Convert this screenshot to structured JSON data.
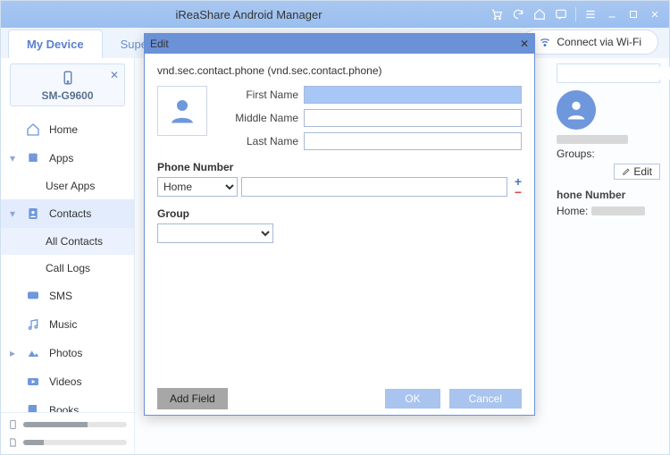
{
  "titlebar": {
    "title": "iReaShare Android Manager"
  },
  "tabs": [
    "My Device",
    "Super Toolkit"
  ],
  "buttons": {
    "connect_wifi": "Connect via Wi-Fi"
  },
  "device": {
    "name": "SM-G9600"
  },
  "nav": {
    "home": "Home",
    "apps": "Apps",
    "user_apps": "User Apps",
    "contacts": "Contacts",
    "all_contacts": "All Contacts",
    "call_logs": "Call Logs",
    "sms": "SMS",
    "music": "Music",
    "photos": "Photos",
    "videos": "Videos",
    "books": "Books"
  },
  "rightpanel": {
    "search_placeholder": "",
    "groups_label": "Groups:",
    "edit": "Edit",
    "phone_section": "hone Number",
    "phone_type": "Home:"
  },
  "dialog": {
    "title": "Edit",
    "subtitle": "vnd.sec.contact.phone (vnd.sec.contact.phone)",
    "first_name_label": "First Name",
    "first_name_value": "",
    "middle_name_label": "Middle Name",
    "middle_name_value": "",
    "last_name_label": "Last Name",
    "last_name_value": "",
    "phone_label": "Phone Number",
    "phone_type": "Home",
    "phone_value": "",
    "group_label": "Group",
    "group_value": "",
    "add_field": "Add Field",
    "ok": "OK",
    "cancel": "Cancel"
  }
}
